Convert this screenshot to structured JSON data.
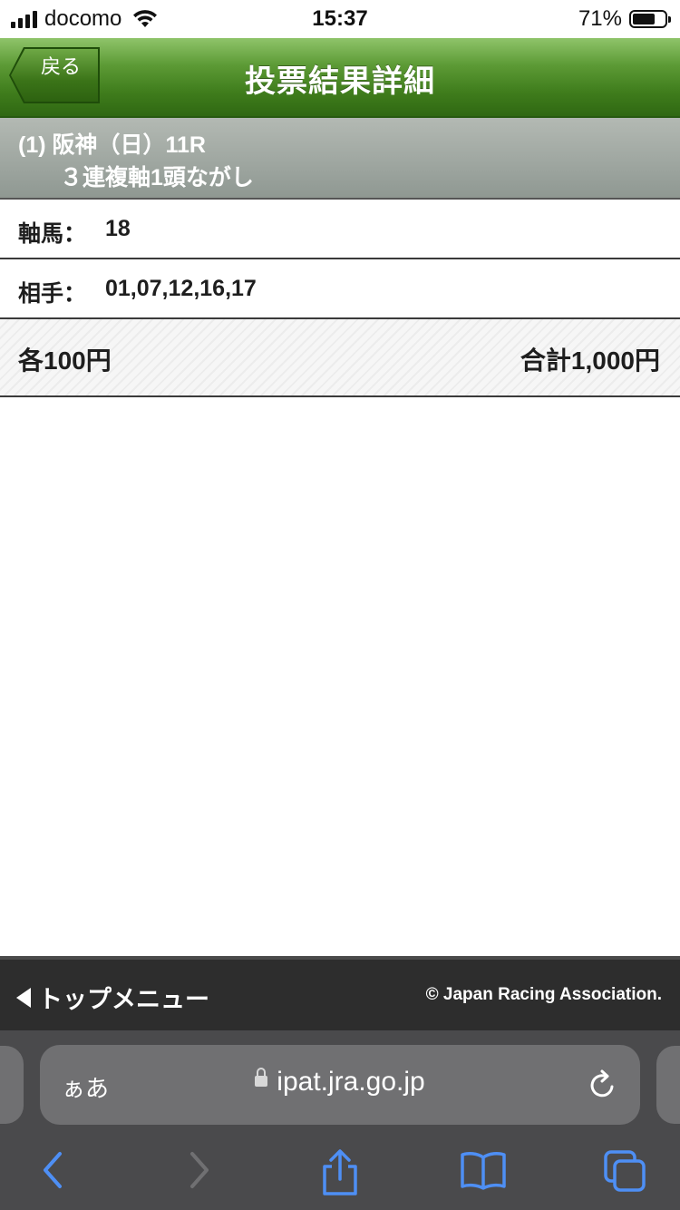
{
  "status_bar": {
    "carrier": "docomo",
    "time": "15:37",
    "battery_percent": "71%",
    "battery_level": 0.71,
    "icons": [
      "cellular-signal-icon",
      "wifi-icon",
      "battery-icon"
    ]
  },
  "header": {
    "back_label": "戻る",
    "title": "投票結果詳細"
  },
  "race": {
    "line1": "(1) 阪神（日）11R",
    "line2": "３連複軸1頭ながし"
  },
  "rows": {
    "axis_label": "軸馬：",
    "axis_value": "18",
    "partner_label": "相手：",
    "partner_value": "01,07,12,16,17"
  },
  "amount": {
    "each": "各100円",
    "total": "合計1,000円"
  },
  "footer": {
    "top_menu": "トップメニュー",
    "copyright": "© Japan Racing Association."
  },
  "browser": {
    "aa_label": "ぁあ",
    "url": "ipat.jra.go.jp",
    "toolbar_icons": [
      "back-arrow-icon",
      "forward-arrow-icon",
      "share-icon",
      "bookmarks-icon",
      "tabs-icon"
    ]
  },
  "colors": {
    "header_green": "#3f7c1c",
    "race_bar_gray": "#9aa29c",
    "footer_dark": "#2d2d2d",
    "safari_blue": "#4e8ff5"
  }
}
